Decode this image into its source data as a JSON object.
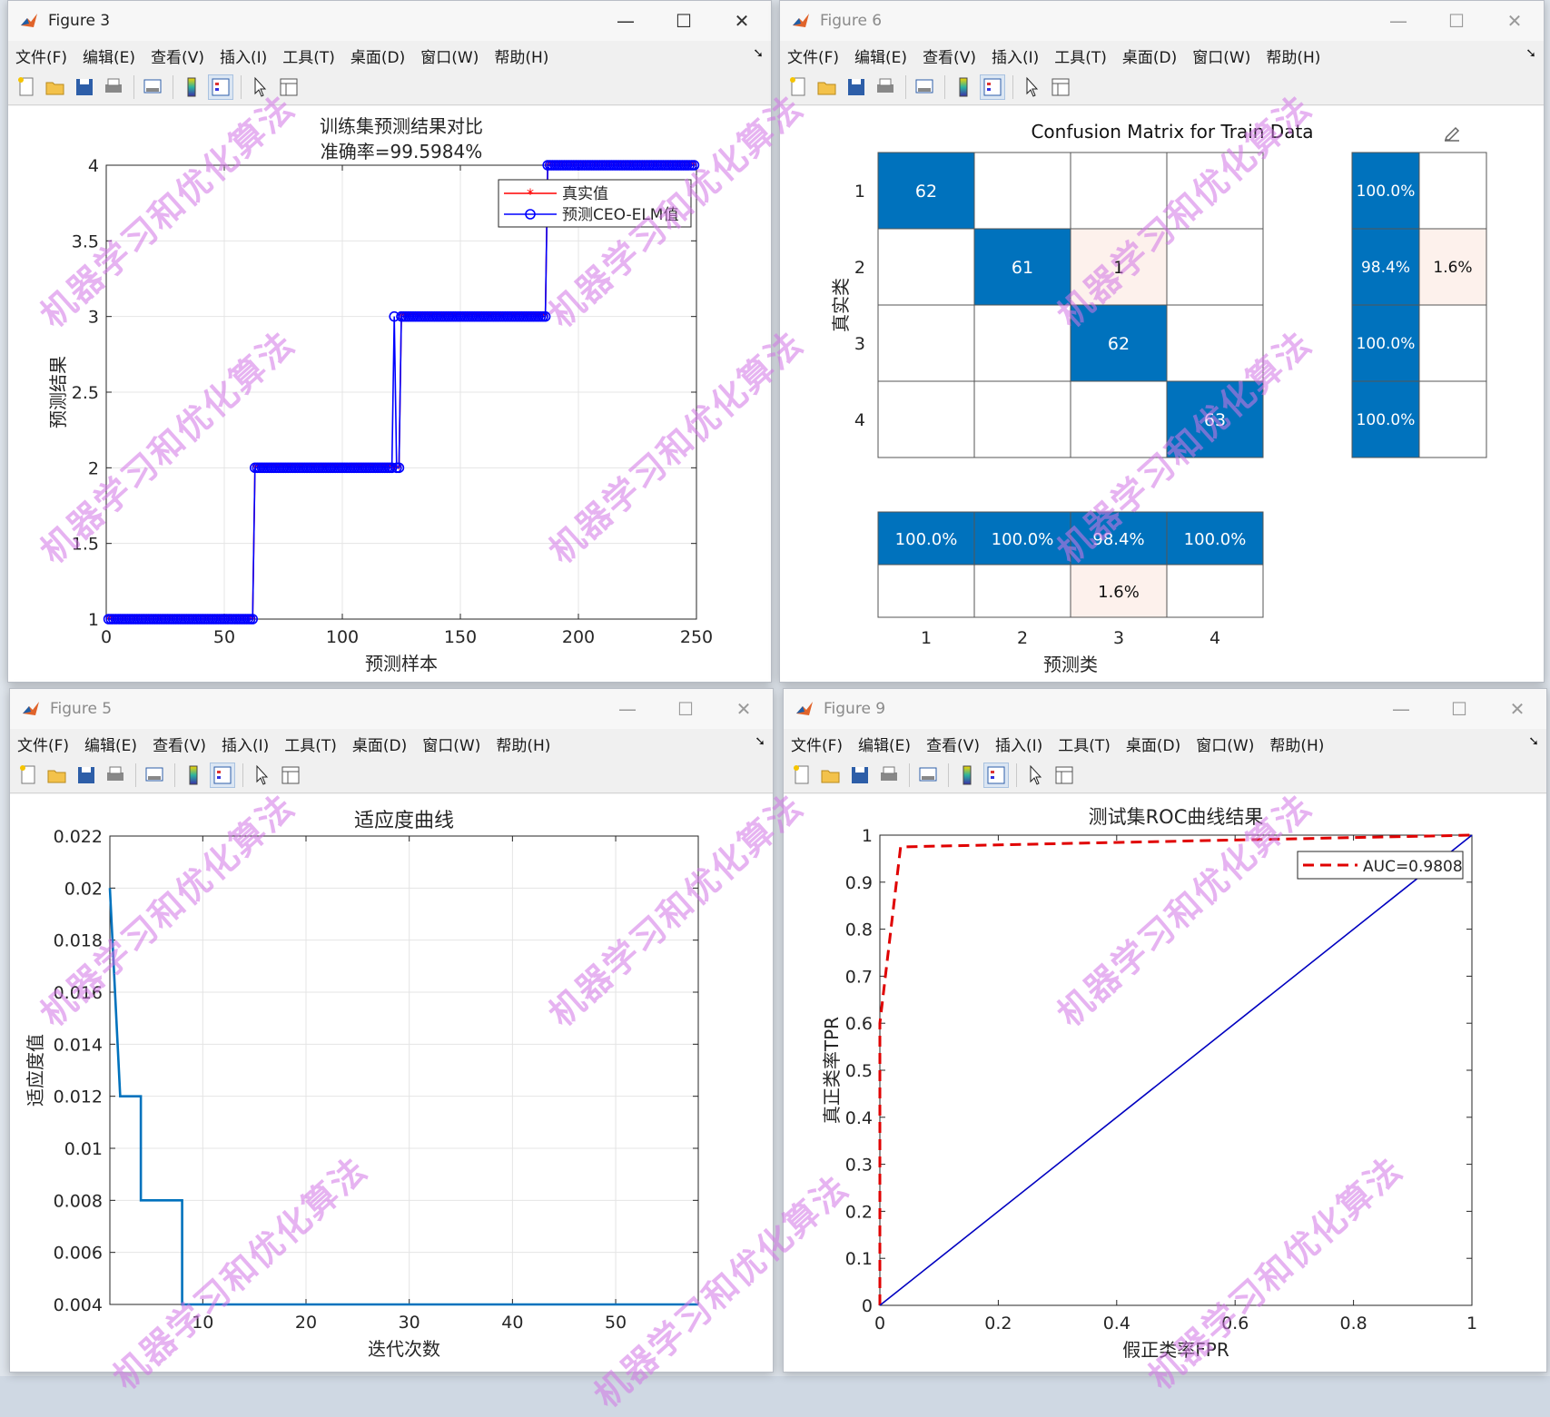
{
  "windows": {
    "fig3": {
      "title": "Figure 3"
    },
    "fig6": {
      "title": "Figure 6"
    },
    "fig5": {
      "title": "Figure 5"
    },
    "fig9": {
      "title": "Figure 9"
    }
  },
  "menu": [
    "文件(F)",
    "编辑(E)",
    "查看(V)",
    "插入(I)",
    "工具(T)",
    "桌面(D)",
    "窗口(W)",
    "帮助(H)"
  ],
  "controls": {
    "minimize": "—",
    "maximize": "☐",
    "close": "✕"
  },
  "watermark": "机器学习和优化算法",
  "chart_data": [
    {
      "id": "fig3",
      "type": "line",
      "title": "训练集预测结果对比",
      "subtitle": "准确率=99.5984%",
      "xlabel": "预测样本",
      "ylabel": "预测结果",
      "xlim": [
        0,
        250
      ],
      "ylim": [
        1,
        4
      ],
      "xticks": [
        0,
        50,
        100,
        150,
        200,
        250
      ],
      "yticks": [
        1,
        1.5,
        2,
        2.5,
        3,
        3.5,
        4
      ],
      "grid": true,
      "legend_position": "top-right",
      "series": [
        {
          "name": "真实值",
          "color": "#ff0000",
          "marker": "*",
          "segments": [
            {
              "from": 1,
              "to": 62,
              "value": 1
            },
            {
              "from": 63,
              "to": 124,
              "value": 2
            },
            {
              "from": 125,
              "to": 186,
              "value": 3
            },
            {
              "from": 187,
              "to": 249,
              "value": 4
            }
          ]
        },
        {
          "name": "预测CEO-ELM值",
          "color": "#0000ff",
          "marker": "o",
          "segments": [
            {
              "from": 1,
              "to": 62,
              "value": 1
            },
            {
              "from": 63,
              "to": 121,
              "value": 2
            },
            {
              "from": 122,
              "to": 122,
              "value": 3
            },
            {
              "from": 123,
              "to": 124,
              "value": 2
            },
            {
              "from": 125,
              "to": 186,
              "value": 3
            },
            {
              "from": 187,
              "to": 249,
              "value": 4
            }
          ]
        }
      ]
    },
    {
      "id": "fig6",
      "type": "heatmap",
      "title": "Confusion Matrix for Train Data",
      "xlabel": "预测类",
      "ylabel": "真实类",
      "classes": [
        "1",
        "2",
        "3",
        "4"
      ],
      "matrix": [
        [
          62,
          0,
          0,
          0
        ],
        [
          0,
          61,
          1,
          0
        ],
        [
          0,
          0,
          62,
          0
        ],
        [
          0,
          0,
          0,
          63
        ]
      ],
      "row_summary": [
        [
          "100.0%",
          ""
        ],
        [
          "98.4%",
          "1.6%"
        ],
        [
          "100.0%",
          ""
        ],
        [
          "100.0%",
          ""
        ]
      ],
      "col_summary": [
        [
          "100.0%",
          ""
        ],
        [
          "100.0%",
          ""
        ],
        [
          "98.4%",
          "1.6%"
        ],
        [
          "100.0%",
          ""
        ]
      ],
      "colors": {
        "correct": "#0072bd",
        "incorrect": "#fdf1ec"
      }
    },
    {
      "id": "fig5",
      "type": "line",
      "title": "适应度曲线",
      "xlabel": "迭代次数",
      "ylabel": "适应度值",
      "xlim": [
        1,
        58
      ],
      "ylim": [
        0.004,
        0.022
      ],
      "xticks": [
        10,
        20,
        30,
        40,
        50
      ],
      "yticks": [
        0.004,
        0.006,
        0.008,
        0.01,
        0.012,
        0.014,
        0.016,
        0.018,
        0.02,
        0.022
      ],
      "ytick_labels": [
        "0.004",
        "0.006",
        "0.008",
        "0.01",
        "0.012",
        "0.014",
        "0.016",
        "0.018",
        "0.02",
        "0.022"
      ],
      "grid": true,
      "series": [
        {
          "color": "#0072bd",
          "x": [
            1,
            2,
            3,
            3,
            4,
            4,
            5,
            7,
            7,
            8,
            8,
            58
          ],
          "y": [
            0.02,
            0.012,
            0.012,
            0.012,
            0.012,
            0.008,
            0.008,
            0.008,
            0.008,
            0.008,
            0.004,
            0.004
          ]
        }
      ]
    },
    {
      "id": "fig9",
      "type": "line",
      "title": "测试集ROC曲线结果",
      "xlabel": "假正类率FPR",
      "ylabel": "真正类率TPR",
      "xlim": [
        0,
        1
      ],
      "ylim": [
        0,
        1
      ],
      "xticks": [
        0,
        0.2,
        0.4,
        0.6,
        0.8,
        1
      ],
      "yticks": [
        0,
        0.1,
        0.2,
        0.3,
        0.4,
        0.5,
        0.6,
        0.7,
        0.8,
        0.9,
        1
      ],
      "grid": false,
      "legend_position": "top-right",
      "series": [
        {
          "name": "AUC=0.9808",
          "color": "#e00000",
          "dash": true,
          "x": [
            0,
            0,
            0.035,
            1
          ],
          "y": [
            0,
            0.6,
            0.975,
            1
          ]
        },
        {
          "color": "#0000c0",
          "x": [
            0,
            1
          ],
          "y": [
            0,
            1
          ]
        }
      ]
    }
  ]
}
